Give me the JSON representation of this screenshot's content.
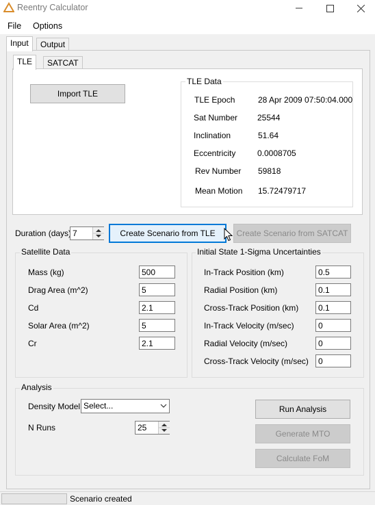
{
  "window": {
    "title": "Reentry Calculator"
  },
  "menu": {
    "file": "File",
    "options": "Options"
  },
  "main_tabs": {
    "input": "Input",
    "output": "Output"
  },
  "sub_tabs": {
    "tle": "TLE",
    "satcat": "SATCAT"
  },
  "import_button": "Import TLE",
  "tle_data": {
    "legend": "TLE Data",
    "rows": [
      {
        "label": "TLE Epoch",
        "value": "28 Apr 2009 07:50:04.000"
      },
      {
        "label": "Sat Number",
        "value": "25544"
      },
      {
        "label": "Inclination",
        "value": "51.64"
      },
      {
        "label": "Eccentricity",
        "value": "0.0008705"
      },
      {
        "label": "Rev Number",
        "value": "59818"
      },
      {
        "label": "Mean Motion",
        "value": "15.72479717"
      }
    ]
  },
  "duration": {
    "label": "Duration (days)",
    "value": "7"
  },
  "buttons": {
    "create_tle": "Create Scenario from TLE",
    "create_satcat": "Create Scenario from SATCAT",
    "run": "Run Analysis",
    "mto": "Generate MTO",
    "fom": "Calculate FoM"
  },
  "satellite_data": {
    "legend": "Satellite Data",
    "rows": [
      {
        "label": "Mass (kg)",
        "value": "500"
      },
      {
        "label": "Drag Area (m^2)",
        "value": "5"
      },
      {
        "label": "Cd",
        "value": "2.1"
      },
      {
        "label": "Solar Area (m^2)",
        "value": "5"
      },
      {
        "label": "Cr",
        "value": "2.1"
      }
    ]
  },
  "uncertainties": {
    "legend": "Initial State 1-Sigma Uncertainties",
    "rows": [
      {
        "label": "In-Track Position (km)",
        "value": "0.5"
      },
      {
        "label": "Radial Position (km)",
        "value": "0.1"
      },
      {
        "label": "Cross-Track Position (km)",
        "value": "0.1"
      },
      {
        "label": "In-Track Velocity (m/sec)",
        "value": "0"
      },
      {
        "label": "Radial Velocity (m/sec)",
        "value": "0"
      },
      {
        "label": "Cross-Track Velocity (m/sec)",
        "value": "0"
      }
    ]
  },
  "analysis": {
    "legend": "Analysis",
    "density_label": "Density Model",
    "density_value": "Select...",
    "nruns_label": "N Runs",
    "nruns_value": "25"
  },
  "status": {
    "text": "Scenario created"
  }
}
